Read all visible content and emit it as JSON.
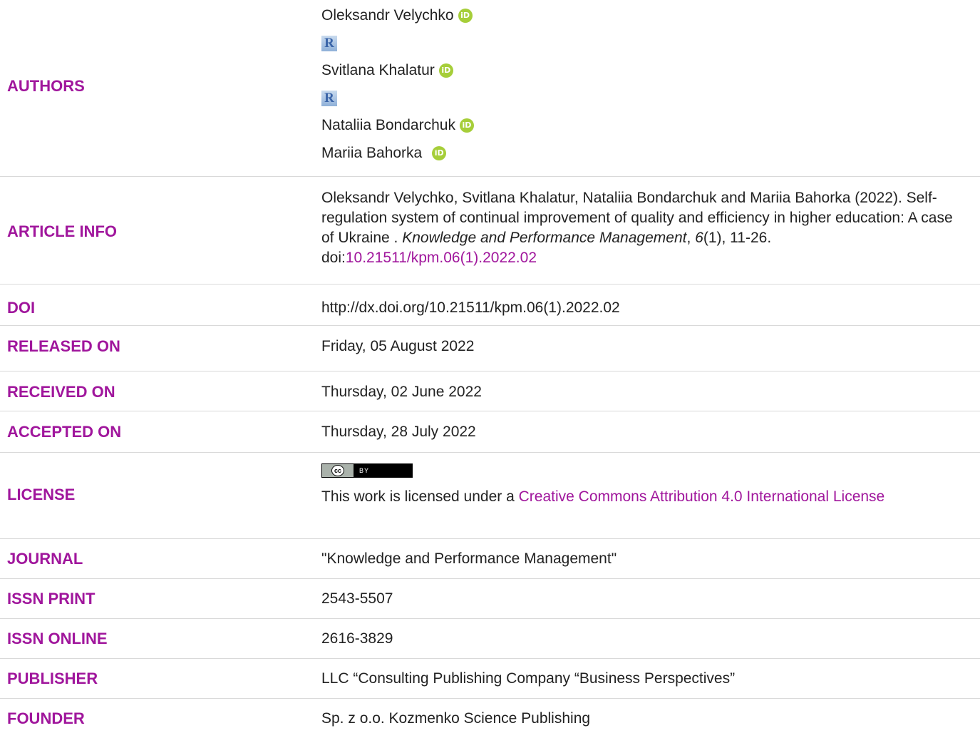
{
  "authors": {
    "label": "AUTHORS",
    "list": [
      {
        "name": "Oleksandr Velychko",
        "orcid": "iD",
        "rid": "R"
      },
      {
        "name": "Svitlana Khalatur",
        "orcid": "iD",
        "rid": "R"
      },
      {
        "name": "Nataliia Bondarchuk",
        "orcid": "iD"
      },
      {
        "name": "Mariia Bahorka",
        "orcid": "iD"
      }
    ]
  },
  "article_info": {
    "label": "ARTICLE INFO",
    "text_1": "Oleksandr Velychko, Svitlana Khalatur, Nataliia Bondarchuk and Mariia Bahorka (2022). Self-regulation system of continual improvement of quality and efficiency in higher education: A case of Ukraine . ",
    "journal_italic": "Knowledge and Performance Management",
    "text_2": ", ",
    "volume_italic": "6",
    "text_3": "(1), 11-26. doi:",
    "doi_link": "10.21511/kpm.06(1).2022.02"
  },
  "doi": {
    "label": "DOI",
    "value": "http://dx.doi.org/10.21511/kpm.06(1).2022.02"
  },
  "released_on": {
    "label": "RELEASED ON",
    "value": "Friday, 05 August 2022"
  },
  "received_on": {
    "label": "RECEIVED ON",
    "value": "Thursday, 02 June 2022"
  },
  "accepted_on": {
    "label": "ACCEPTED ON",
    "value": "Thursday, 28 July 2022"
  },
  "license": {
    "label": "LICENSE",
    "badge_cc": "cc",
    "badge_by": "BY",
    "text": "This work is licensed under a ",
    "link": "Creative Commons Attribution 4.0 International License"
  },
  "journal": {
    "label": "JOURNAL",
    "value": "\"Knowledge and Performance Management\""
  },
  "issn_print": {
    "label": "ISSN PRINT",
    "value": "2543-5507"
  },
  "issn_online": {
    "label": "ISSN ONLINE",
    "value": "2616-3829"
  },
  "publisher": {
    "label": "PUBLISHER",
    "value": "LLC “Consulting Publishing Company “Business Perspectives”"
  },
  "founder": {
    "label": "FOUNDER",
    "value": "Sp. z o.o. Kozmenko Science Publishing"
  },
  "colors": {
    "label": "#a0169c",
    "link": "#a0169c",
    "orcid": "#a6ce39",
    "separator": "#d9d9d9"
  }
}
